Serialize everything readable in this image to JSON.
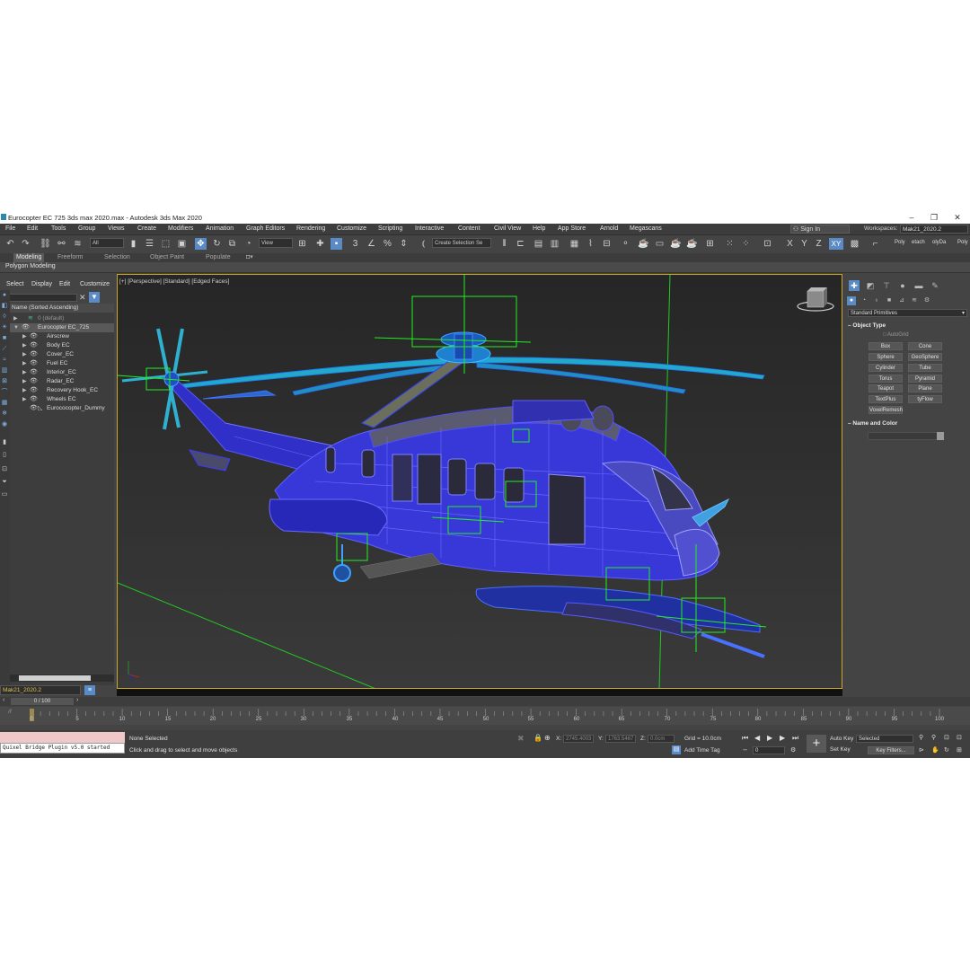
{
  "window": {
    "title": "Eurocopter EC 725 3ds max 2020.max - Autodesk 3ds Max 2020",
    "minimize": "–",
    "maximize": "❐",
    "close": "✕"
  },
  "menu": [
    "File",
    "Edit",
    "Tools",
    "Group",
    "Views",
    "Create",
    "Modifiers",
    "Animation",
    "Graph Editors",
    "Rendering",
    "Customize",
    "Scripting",
    "Interactive",
    "Content",
    "Civil View",
    "Help",
    "App Store",
    "Arnold",
    "Megascans"
  ],
  "account": {
    "sign_in": "Sign In",
    "workspaces_label": "Workspaces:",
    "workspace": "Mak21_2020.2"
  },
  "toolbar": {
    "filter": "All",
    "ref_coord": "View",
    "selection_set": "Create Selection Se",
    "axes": [
      "X",
      "Y",
      "Z",
      "XY"
    ],
    "right_tabs": [
      "Poly",
      "etach",
      "olyDa",
      "Poly"
    ]
  },
  "ribbon": {
    "tabs": [
      "Modeling",
      "Freeform",
      "Selection",
      "Object Paint",
      "Populate"
    ],
    "active": "Modeling",
    "sub": "Polygon Modeling"
  },
  "scene_explorer": {
    "menu": [
      "Select",
      "Display",
      "Edit",
      "Customize"
    ],
    "header": "Name (Sorted Ascending)",
    "rows": [
      {
        "label": "0 (default)",
        "indent": 1,
        "muted": true
      },
      {
        "label": "Eurocopter EC_725",
        "indent": 1,
        "expanded": true,
        "selected": true
      },
      {
        "label": "Airscrew",
        "indent": 2
      },
      {
        "label": "Body EC",
        "indent": 2
      },
      {
        "label": "Cover_EC",
        "indent": 2
      },
      {
        "label": "Fuel EC",
        "indent": 2
      },
      {
        "label": "Interior_EC",
        "indent": 2
      },
      {
        "label": "Radar_EC",
        "indent": 2
      },
      {
        "label": "Recovery Hook_EC",
        "indent": 2
      },
      {
        "label": "Wheels EC",
        "indent": 2
      },
      {
        "label": "Eurococopter_Dummy",
        "indent": 2,
        "leaf": true
      }
    ],
    "layer": "Mak21_2020.2"
  },
  "viewport": {
    "label": "[+] [Perspective] [Standard] [Edged Faces]",
    "wire_color": "#3a3aff",
    "helper_color": "#22ee22"
  },
  "command_panel": {
    "category": "Standard Primitives",
    "object_type_title": "Object Type",
    "autogrid": "AutoGrid",
    "buttons": [
      "Box",
      "Cone",
      "Sphere",
      "GeoSphere",
      "Cylinder",
      "Tube",
      "Torus",
      "Pyramid",
      "Teapot",
      "Plane",
      "TextPlus",
      "tyFlow",
      "VoxelRemesh"
    ],
    "name_color_title": "Name and Color"
  },
  "timeline": {
    "slider": "0 / 100",
    "ticks": [
      "0",
      "5",
      "10",
      "15",
      "20",
      "25",
      "30",
      "35",
      "40",
      "45",
      "50",
      "55",
      "60",
      "65",
      "70",
      "75",
      "80",
      "85",
      "90",
      "95",
      "100"
    ]
  },
  "status": {
    "maxscript": "Quixel Bridge Plugin v5.0 started",
    "selection": "None Selected",
    "prompt": "Click and drag to select and move objects",
    "x_label": "X:",
    "x_value": "2745.4003",
    "y_label": "Y:",
    "y_value": "1763.5467",
    "z_label": "Z:",
    "z_value": "0.0cm",
    "grid": "Grid = 10.0cm",
    "add_time_tag": "Add Time Tag",
    "frame": "0",
    "auto_key": "Auto Key",
    "set_key": "Set Key",
    "selected": "Selected",
    "key_filters": "Key Filters..."
  }
}
